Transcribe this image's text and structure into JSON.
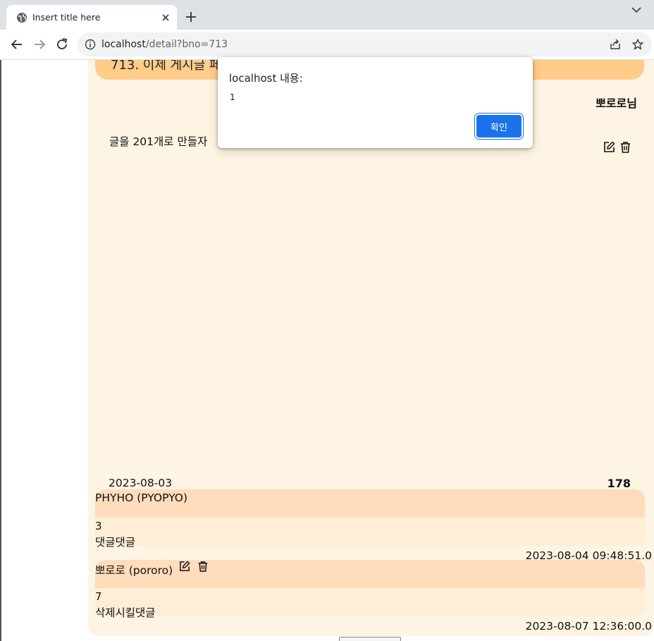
{
  "browser": {
    "tab_title": "Insert title here",
    "url_host": "localhost",
    "url_path": "/detail?bno=713"
  },
  "post": {
    "title": "713. 이제 게시글 페",
    "author": "뽀로로님",
    "content": "글을 201개로 만들자",
    "date": "2023-08-03",
    "views": "178"
  },
  "comments": [
    {
      "writer": "PHYHO (PYOPYO)",
      "number": "3",
      "text": "댓글댓글",
      "date": "2023-08-04 09:48:51.0"
    },
    {
      "writer": "뽀로로 (pororo)",
      "number": "7",
      "text": "삭제시킬댓글",
      "date": "2023-08-07 12:36:00.0"
    }
  ],
  "dialog": {
    "title": "localhost 내용:",
    "message": "1",
    "ok_label": "확인"
  },
  "colors": {
    "title_bar": "#ffcc8a",
    "card_bg": "#fdf4e3",
    "comment_head": "#ffdcbb",
    "comment_body": "#ffeed6",
    "dialog_button": "#1a73e8"
  },
  "icons": {
    "tab": "globe-icon",
    "close_tab": "close-icon",
    "new_tab": "plus-icon",
    "back": "back-arrow-icon",
    "forward": "forward-arrow-icon",
    "reload": "reload-icon",
    "site_info": "info-icon",
    "share": "share-icon",
    "bookmark": "star-icon",
    "edit": "edit-icon",
    "delete": "trash-icon"
  }
}
